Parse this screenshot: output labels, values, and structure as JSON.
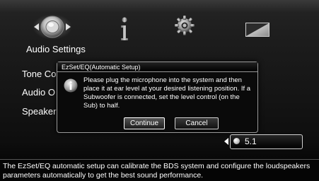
{
  "nav": {
    "icons": [
      "audio-settings-icon",
      "info-icon",
      "gear-icon",
      "display-icon"
    ],
    "selected_label": "Audio Settings"
  },
  "menu": {
    "items": [
      "Tone Co",
      "Audio O",
      "Speaker"
    ]
  },
  "dialog": {
    "title": "EzSet/EQ(Automatic Setup)",
    "message": "Please plug the microphone into the system and then place it at ear level at your desired listening position. If a Subwoofer is connected, set the level control (on the Sub) to half.",
    "icon": "info-icon",
    "continue_label": "Continue",
    "cancel_label": "Cancel"
  },
  "selector": {
    "value": "5.1"
  },
  "help": {
    "text": "The EzSet/EQ automatic setup can calibrate the BDS system and configure the loudspeakers parameters automatically to get the best sound performance."
  }
}
